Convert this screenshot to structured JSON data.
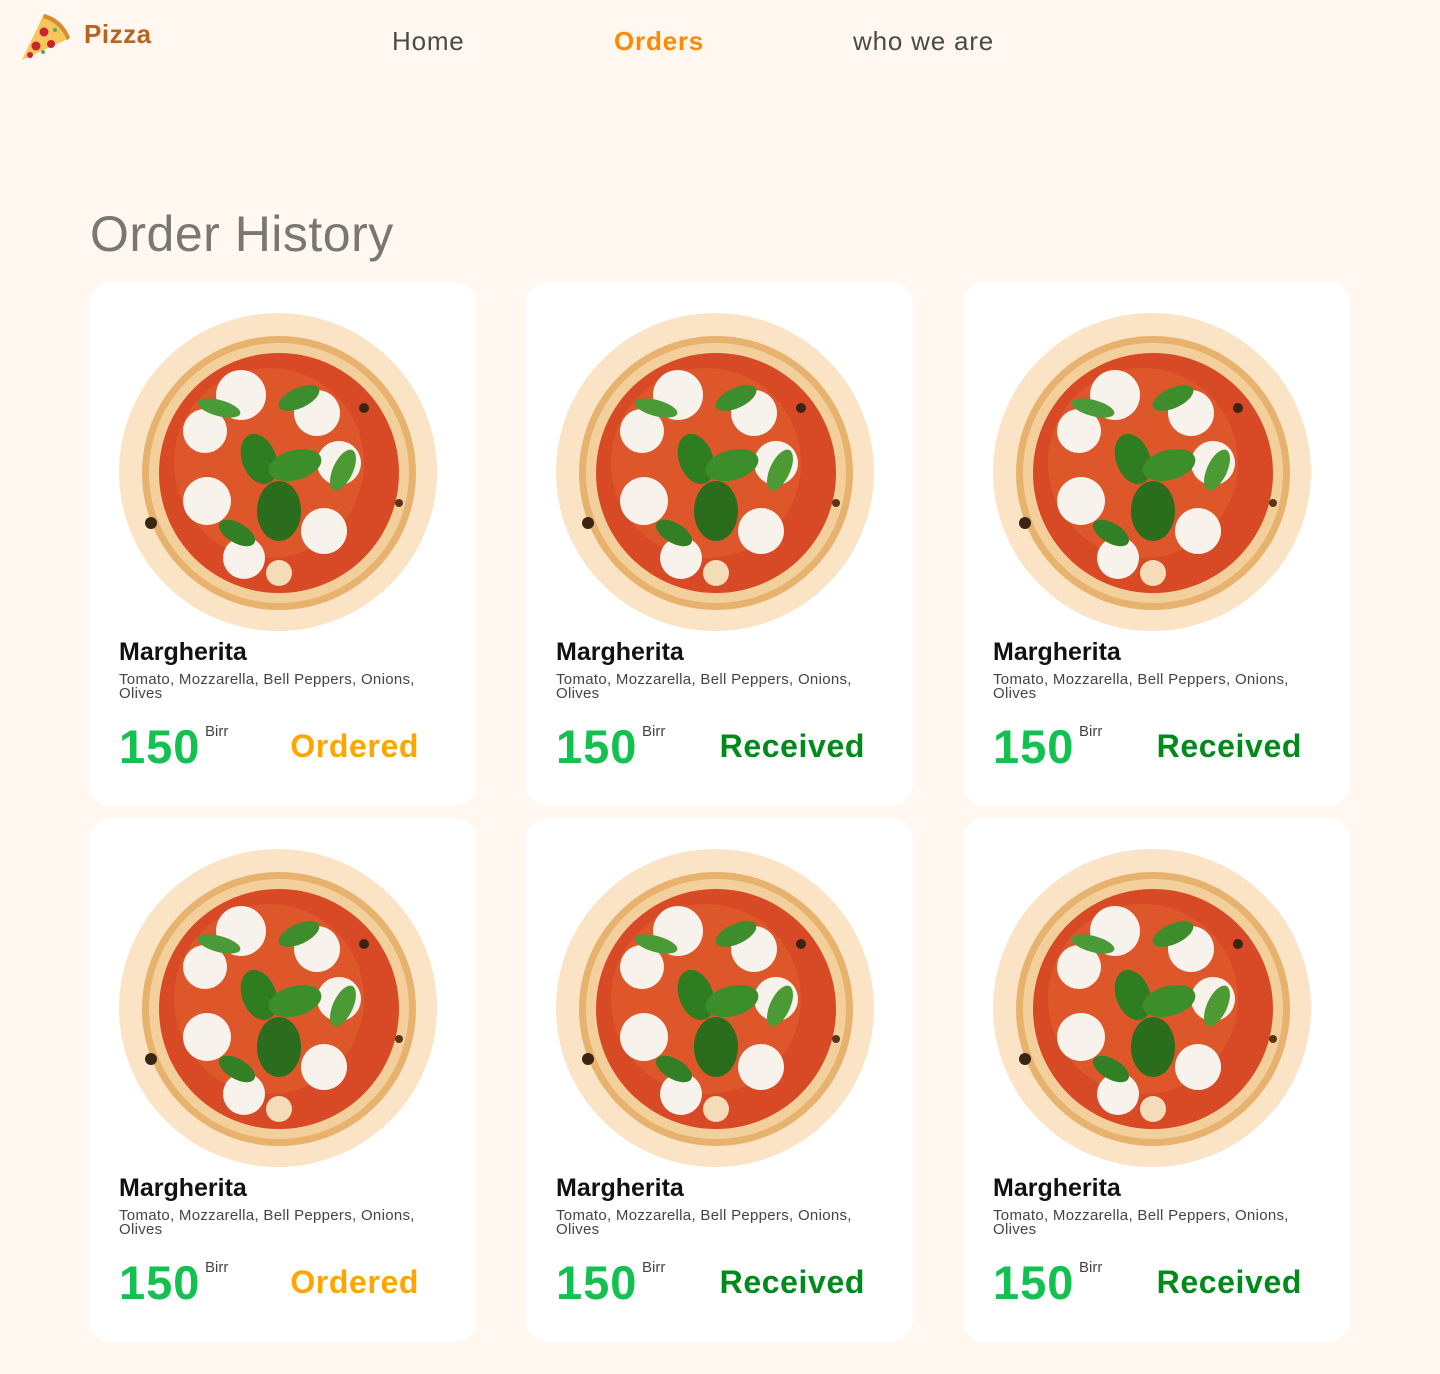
{
  "nav": {
    "brand": "Pizza",
    "links": [
      {
        "label": "Home"
      },
      {
        "label": "Orders",
        "active": true
      },
      {
        "label": "who we are"
      }
    ]
  },
  "page": {
    "title": "Order History"
  },
  "currency": "Birr",
  "colors": {
    "background": "#fff7f0",
    "accent": "#ff8a00",
    "price": "#12c14f",
    "ordered": "#ffa500",
    "received": "#008a1c"
  },
  "orders": [
    {
      "name": "Margherita",
      "description": "Tomato, Mozzarella, Bell Peppers, Onions, Olives",
      "price": "150",
      "status": "Ordered"
    },
    {
      "name": "Margherita",
      "description": "Tomato, Mozzarella, Bell Peppers, Onions, Olives",
      "price": "150",
      "status": "Received"
    },
    {
      "name": "Margherita",
      "description": "Tomato, Mozzarella, Bell Peppers, Onions, Olives",
      "price": "150",
      "status": "Received"
    },
    {
      "name": "Margherita",
      "description": "Tomato, Mozzarella, Bell Peppers, Onions, Olives",
      "price": "150",
      "status": "Ordered"
    },
    {
      "name": "Margherita",
      "description": "Tomato, Mozzarella, Bell Peppers, Onions, Olives",
      "price": "150",
      "status": "Received"
    },
    {
      "name": "Margherita",
      "description": "Tomato, Mozzarella, Bell Peppers, Onions, Olives",
      "price": "150",
      "status": "Received"
    }
  ]
}
